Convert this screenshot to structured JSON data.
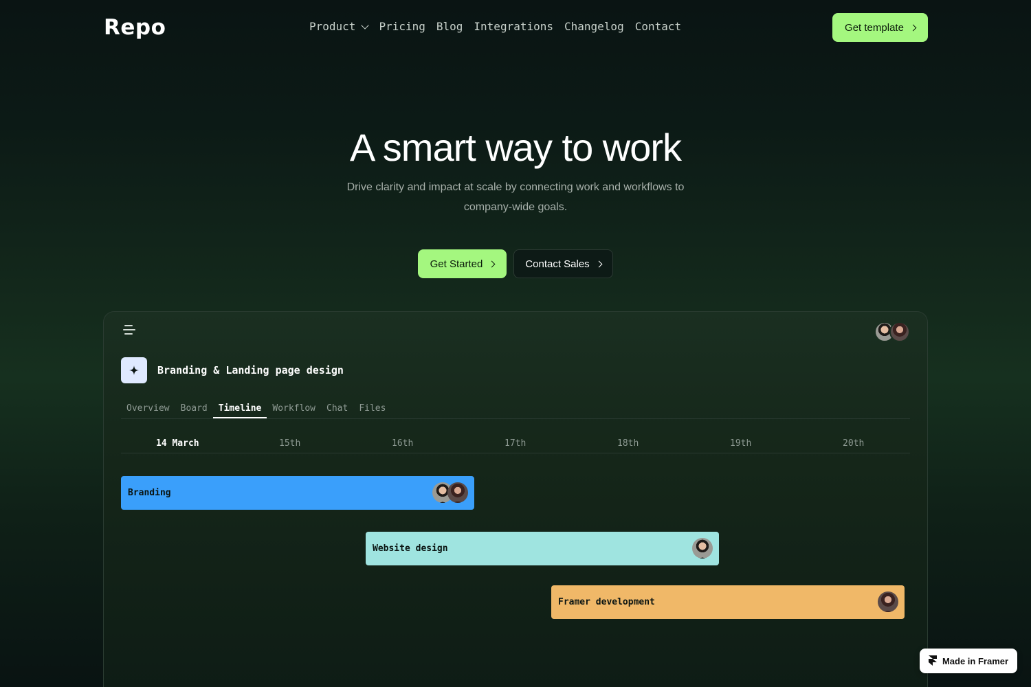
{
  "nav": {
    "logo": "Repo",
    "links": [
      "Product",
      "Pricing",
      "Blog",
      "Integrations",
      "Changelog",
      "Contact"
    ],
    "cta": "Get template"
  },
  "hero": {
    "title": "A smart way to work",
    "subtitle": "Drive clarity and impact at scale by connecting work and workflows to company-wide goals.",
    "primary_button": "Get Started",
    "secondary_button": "Contact Sales"
  },
  "app": {
    "project_title": "Branding & Landing page design",
    "tabs": [
      "Overview",
      "Board",
      "Timeline",
      "Workflow",
      "Chat",
      "Files"
    ],
    "active_tab": "Timeline",
    "dates": [
      "14 March",
      "15th",
      "16th",
      "17th",
      "18th",
      "19th",
      "20th"
    ],
    "tasks": [
      {
        "label": "Branding",
        "color": "#3a9ffb"
      },
      {
        "label": "Website design",
        "color": "#9fe4e0"
      },
      {
        "label": "Framer development",
        "color": "#f0b868"
      }
    ]
  },
  "badge": {
    "label": "Made in Framer"
  },
  "colors": {
    "accent": "#a4f77f"
  }
}
